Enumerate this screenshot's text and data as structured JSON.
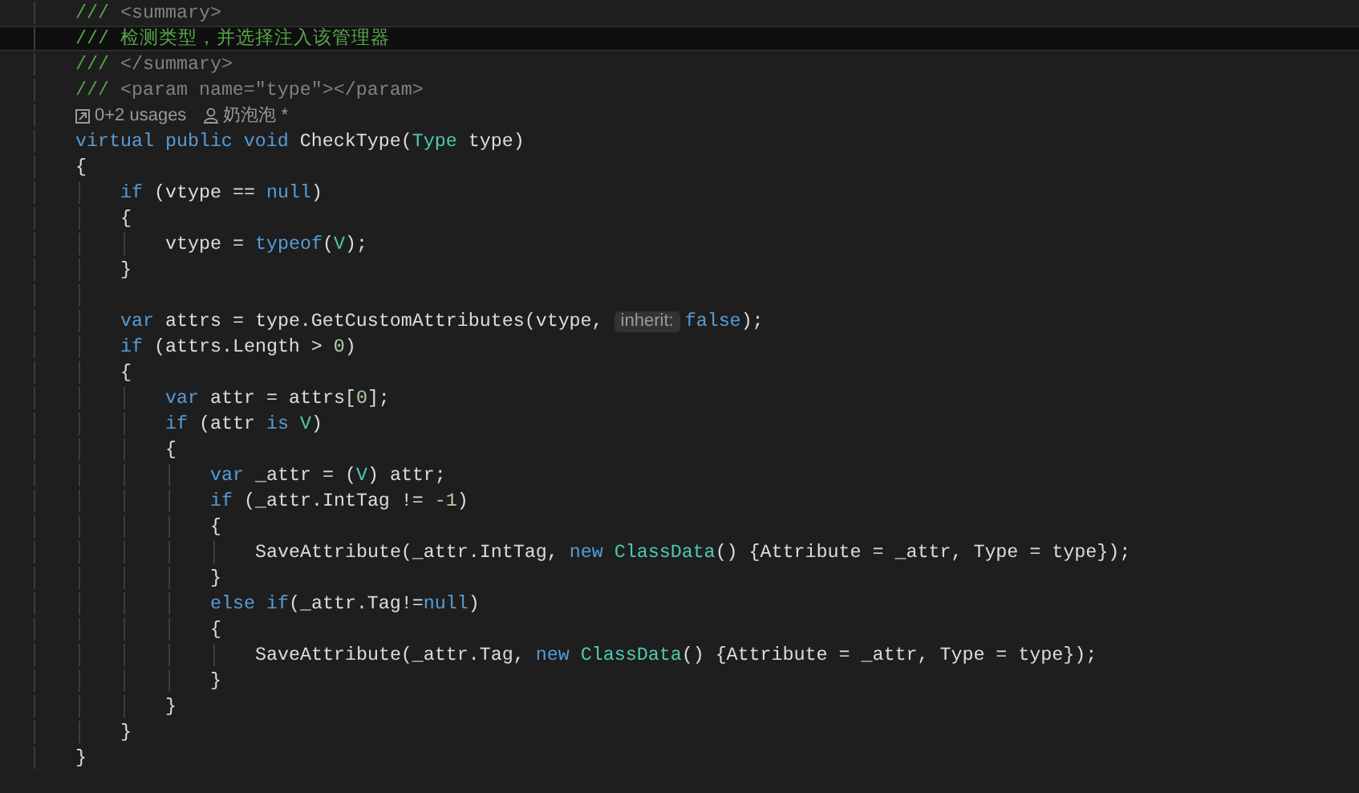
{
  "editor": {
    "lines": [
      {
        "kind": "code",
        "current": false,
        "tokens": [
          {
            "kind": "comment",
            "text": "    /// "
          },
          {
            "kind": "doc",
            "text": "<summary>"
          }
        ]
      },
      {
        "kind": "code",
        "current": true,
        "tokens": [
          {
            "kind": "comment",
            "text": "    /// 检测类型，并选择注入该管理器"
          }
        ]
      },
      {
        "kind": "code",
        "current": false,
        "tokens": [
          {
            "kind": "comment",
            "text": "    /// "
          },
          {
            "kind": "doc",
            "text": "</summary>"
          }
        ]
      },
      {
        "kind": "code",
        "current": false,
        "tokens": [
          {
            "kind": "comment",
            "text": "    /// "
          },
          {
            "kind": "doc",
            "text": "<param name=\"type\"></param>"
          }
        ]
      },
      {
        "kind": "codelens",
        "current": false,
        "usages": "0+2 usages",
        "author": "奶泡泡 *"
      },
      {
        "kind": "code",
        "current": false,
        "tokens": [
          {
            "kind": "keyword",
            "text": "    virtual public void"
          },
          {
            "kind": "plain",
            "text": " CheckType("
          },
          {
            "kind": "type",
            "text": "Type"
          },
          {
            "kind": "plain",
            "text": " type)"
          }
        ]
      },
      {
        "kind": "code",
        "current": false,
        "tokens": [
          {
            "kind": "plain",
            "text": "    {"
          }
        ]
      },
      {
        "kind": "code",
        "current": false,
        "tokens": [
          {
            "kind": "keyword",
            "text": "        if"
          },
          {
            "kind": "plain",
            "text": " (vtype == "
          },
          {
            "kind": "keyword",
            "text": "null"
          },
          {
            "kind": "plain",
            "text": ")"
          }
        ]
      },
      {
        "kind": "code",
        "current": false,
        "tokens": [
          {
            "kind": "plain",
            "text": "        {"
          }
        ]
      },
      {
        "kind": "code",
        "current": false,
        "tokens": [
          {
            "kind": "plain",
            "text": "            vtype = "
          },
          {
            "kind": "keyword",
            "text": "typeof"
          },
          {
            "kind": "plain",
            "text": "("
          },
          {
            "kind": "type",
            "text": "V"
          },
          {
            "kind": "plain",
            "text": ");"
          }
        ]
      },
      {
        "kind": "code",
        "current": false,
        "tokens": [
          {
            "kind": "plain",
            "text": "        }"
          }
        ]
      },
      {
        "kind": "blank",
        "current": false
      },
      {
        "kind": "code",
        "current": false,
        "tokens": [
          {
            "kind": "keyword",
            "text": "        var"
          },
          {
            "kind": "plain",
            "text": " attrs = type.GetCustomAttributes(vtype, "
          },
          {
            "kind": "hint",
            "text": "inherit:"
          },
          {
            "kind": "keyword",
            "text": "false"
          },
          {
            "kind": "plain",
            "text": ");"
          }
        ]
      },
      {
        "kind": "code",
        "current": false,
        "tokens": [
          {
            "kind": "keyword",
            "text": "        if"
          },
          {
            "kind": "plain",
            "text": " (attrs.Length > "
          },
          {
            "kind": "number",
            "text": "0"
          },
          {
            "kind": "plain",
            "text": ")"
          }
        ]
      },
      {
        "kind": "code",
        "current": false,
        "tokens": [
          {
            "kind": "plain",
            "text": "        {"
          }
        ]
      },
      {
        "kind": "code",
        "current": false,
        "tokens": [
          {
            "kind": "keyword",
            "text": "            var"
          },
          {
            "kind": "plain",
            "text": " attr = attrs["
          },
          {
            "kind": "number",
            "text": "0"
          },
          {
            "kind": "plain",
            "text": "];"
          }
        ]
      },
      {
        "kind": "code",
        "current": false,
        "tokens": [
          {
            "kind": "keyword",
            "text": "            if"
          },
          {
            "kind": "plain",
            "text": " (attr "
          },
          {
            "kind": "keyword",
            "text": "is "
          },
          {
            "kind": "type",
            "text": "V"
          },
          {
            "kind": "plain",
            "text": ")"
          }
        ]
      },
      {
        "kind": "code",
        "current": false,
        "tokens": [
          {
            "kind": "plain",
            "text": "            {"
          }
        ]
      },
      {
        "kind": "code",
        "current": false,
        "tokens": [
          {
            "kind": "keyword",
            "text": "                var"
          },
          {
            "kind": "plain",
            "text": " _attr = ("
          },
          {
            "kind": "type",
            "text": "V"
          },
          {
            "kind": "plain",
            "text": ") attr;"
          }
        ]
      },
      {
        "kind": "code",
        "current": false,
        "tokens": [
          {
            "kind": "keyword",
            "text": "                if"
          },
          {
            "kind": "plain",
            "text": " (_attr.IntTag != "
          },
          {
            "kind": "number",
            "text": "-1"
          },
          {
            "kind": "plain",
            "text": ")"
          }
        ]
      },
      {
        "kind": "code",
        "current": false,
        "tokens": [
          {
            "kind": "plain",
            "text": "                {"
          }
        ]
      },
      {
        "kind": "code",
        "current": false,
        "tokens": [
          {
            "kind": "plain",
            "text": "                    SaveAttribute(_attr.IntTag, "
          },
          {
            "kind": "keyword",
            "text": "new "
          },
          {
            "kind": "type",
            "text": "ClassData"
          },
          {
            "kind": "plain",
            "text": "() {Attribute = _attr, Type = type});"
          }
        ]
      },
      {
        "kind": "code",
        "current": false,
        "tokens": [
          {
            "kind": "plain",
            "text": "                }"
          }
        ]
      },
      {
        "kind": "code",
        "current": false,
        "tokens": [
          {
            "kind": "keyword",
            "text": "                else if"
          },
          {
            "kind": "plain",
            "text": "(_attr.Tag!="
          },
          {
            "kind": "keyword",
            "text": "null"
          },
          {
            "kind": "plain",
            "text": ")"
          }
        ]
      },
      {
        "kind": "code",
        "current": false,
        "tokens": [
          {
            "kind": "plain",
            "text": "                {"
          }
        ]
      },
      {
        "kind": "code",
        "current": false,
        "tokens": [
          {
            "kind": "plain",
            "text": "                    SaveAttribute(_attr.Tag, "
          },
          {
            "kind": "keyword",
            "text": "new "
          },
          {
            "kind": "type",
            "text": "ClassData"
          },
          {
            "kind": "plain",
            "text": "() {Attribute = _attr, Type = type});"
          }
        ]
      },
      {
        "kind": "code",
        "current": false,
        "tokens": [
          {
            "kind": "plain",
            "text": "                }"
          }
        ]
      },
      {
        "kind": "code",
        "current": false,
        "tokens": [
          {
            "kind": "plain",
            "text": "            }"
          }
        ]
      },
      {
        "kind": "code",
        "current": false,
        "tokens": [
          {
            "kind": "plain",
            "text": "        }"
          }
        ]
      },
      {
        "kind": "code",
        "current": false,
        "tokens": [
          {
            "kind": "plain",
            "text": "    }"
          }
        ]
      }
    ]
  }
}
